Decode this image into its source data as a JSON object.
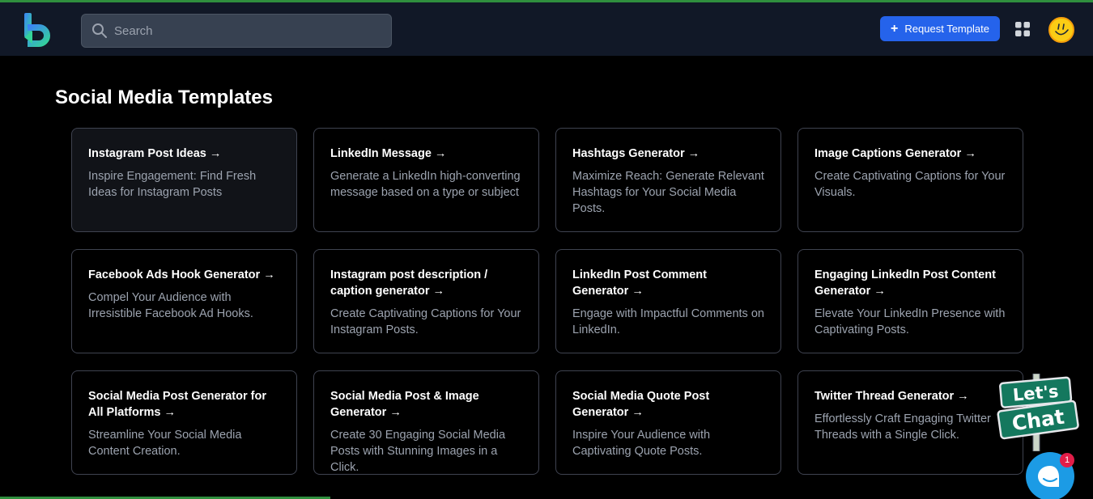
{
  "header": {
    "search": {
      "placeholder": "Search",
      "value": ""
    },
    "request_button_label": "Request Template",
    "accent": "#2563eb"
  },
  "page": {
    "title": "Social Media Templates"
  },
  "templates": [
    {
      "title": "Instagram Post Ideas →",
      "description": "Inspire Engagement: Find Fresh Ideas for Instagram Posts"
    },
    {
      "title": "LinkedIn Message →",
      "description": "Generate a LinkedIn high-converting message based on a type or subject"
    },
    {
      "title": "Hashtags Generator →",
      "description": "Maximize Reach: Generate Relevant Hashtags for Your Social Media Posts."
    },
    {
      "title": "Image Captions Generator →",
      "description": "Create Captivating Captions for Your Visuals."
    },
    {
      "title": "Facebook Ads Hook Generator →",
      "description": "Compel Your Audience with Irresistible Facebook Ad Hooks."
    },
    {
      "title": "Instagram post description / caption generator →",
      "description": "Create Captivating Captions for Your Instagram Posts."
    },
    {
      "title": "LinkedIn Post Comment Generator →",
      "description": "Engage with Impactful Comments on LinkedIn."
    },
    {
      "title": "Engaging LinkedIn Post Content Generator →",
      "description": "Elevate Your LinkedIn Presence with Captivating Posts."
    },
    {
      "title": "Social Media Post Generator for All Platforms →",
      "description": "Streamline Your Social Media Content Creation."
    },
    {
      "title": "Social Media Post & Image Generator →",
      "description": "Create 30 Engaging Social Media Posts with Stunning Images in a Click."
    },
    {
      "title": "Social Media Quote Post Generator →",
      "description": "Inspire Your Audience with Captivating Quote Posts."
    },
    {
      "title": "Twitter Thread Generator →",
      "description": "Effortlessly Craft Engaging Twitter Threads with a Single Click."
    }
  ],
  "chat_widget": {
    "sign_line1": "Let's",
    "sign_line2": "Chat",
    "badge_count": "1"
  }
}
